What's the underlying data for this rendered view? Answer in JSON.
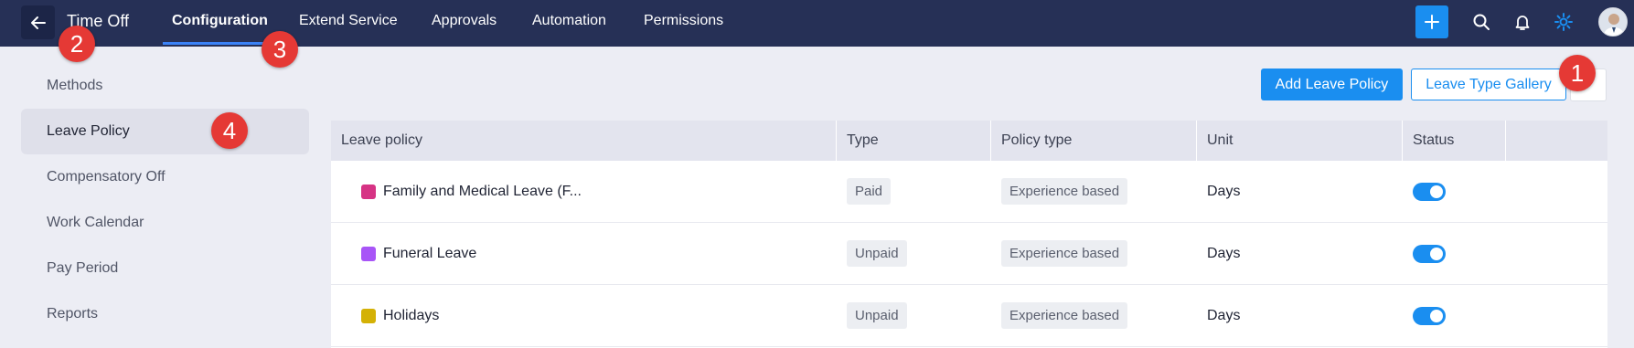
{
  "header": {
    "title": "Time Off",
    "tabs": [
      {
        "label": "Configuration",
        "active": true
      },
      {
        "label": "Extend Service",
        "active": false
      },
      {
        "label": "Approvals",
        "active": false
      },
      {
        "label": "Automation",
        "active": false
      },
      {
        "label": "Permissions",
        "active": false
      }
    ],
    "icons": [
      "back-arrow-icon",
      "plus-icon",
      "search-icon",
      "bell-icon",
      "gear-icon",
      "avatar"
    ]
  },
  "sidebar": {
    "items": [
      {
        "label": "Methods",
        "active": false
      },
      {
        "label": "Leave Policy",
        "active": true
      },
      {
        "label": "Compensatory Off",
        "active": false
      },
      {
        "label": "Work Calendar",
        "active": false
      },
      {
        "label": "Pay Period",
        "active": false
      },
      {
        "label": "Reports",
        "active": false
      }
    ]
  },
  "actions": {
    "add_label": "Add Leave Policy",
    "gallery_label": "Leave Type Gallery"
  },
  "table": {
    "headers": [
      "Leave policy",
      "Type",
      "Policy type",
      "Unit",
      "Status"
    ],
    "rows": [
      {
        "name": "Family and Medical Leave (F...",
        "color": "#d63384",
        "type": "Paid",
        "policy_type": "Experience based",
        "unit": "Days",
        "status": true
      },
      {
        "name": "Funeral Leave",
        "color": "#a855f7",
        "type": "Unpaid",
        "policy_type": "Experience based",
        "unit": "Days",
        "status": true
      },
      {
        "name": "Holidays",
        "color": "#d4b106",
        "type": "Unpaid",
        "policy_type": "Experience based",
        "unit": "Days",
        "status": true
      }
    ]
  },
  "markers": [
    "1",
    "2",
    "3",
    "4"
  ],
  "colors": {
    "topbar": "#263056",
    "accent": "#1a8ef0",
    "marker": "#e53935"
  }
}
